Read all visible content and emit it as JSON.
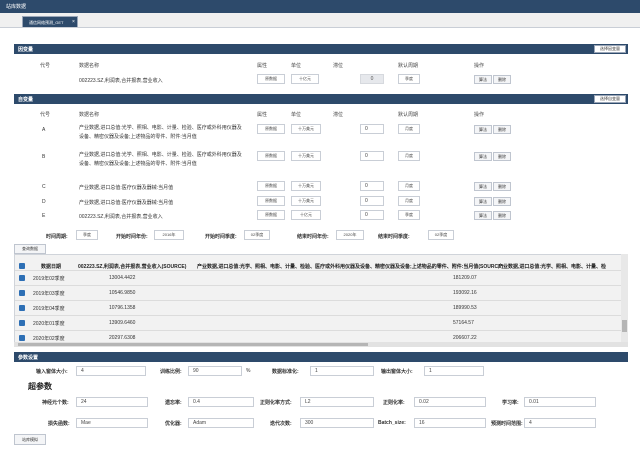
{
  "topbar": {
    "title": "站库数据"
  },
  "tab": {
    "label": "通信网络预测_GET",
    "close": "×"
  },
  "dependent": {
    "title": "因变量",
    "select_btn": "选择因变量",
    "headers": {
      "code": "代号",
      "name": "数据名称",
      "attr": "属性",
      "unit": "单位",
      "lag": "滞位",
      "freq": "默认周期",
      "ops": "操作"
    },
    "row": {
      "name": "002223.SZ,利润表,合并报表,营业收入",
      "attr": "原数据",
      "unit": "十亿元",
      "lag": "0",
      "freq": "季度",
      "btn_edit": "算法",
      "btn_del": "删除"
    }
  },
  "independent": {
    "title": "自变量",
    "select_btn": "选择自变量",
    "headers": {
      "code": "代号",
      "name": "数据名称",
      "attr": "属性",
      "unit": "单位",
      "lag": "滞位",
      "freq": "默认周期",
      "ops": "操作"
    },
    "rows": [
      {
        "code": "A",
        "name": "产业数据,进口总值:光学、照相、电影、计量、检验、医疗或外科用仪器及设备、精密仪器及设备;上述物品的零件、附件:当月值",
        "attr": "原数据",
        "unit": "十万美元",
        "lag": "0",
        "freq": "月度",
        "btn_edit": "算法",
        "btn_del": "删除"
      },
      {
        "code": "B",
        "name": "产业数据,进口总值:光学、照相、电影、计量、检验、医疗或外科用仪器及设备、精密仪器及设备;上述物品的零件、附件:当月值",
        "attr": "原数据",
        "unit": "十万美元",
        "lag": "0",
        "freq": "月度",
        "btn_edit": "算法",
        "btn_del": "删除"
      },
      {
        "code": "C",
        "name": "产业数据,进口总值:医疗仪器及器械:当月值",
        "attr": "原数据",
        "unit": "十万美元",
        "lag": "0",
        "freq": "月度",
        "btn_edit": "算法",
        "btn_del": "删除"
      },
      {
        "code": "D",
        "name": "产业数据,进口总值:医疗仪器及器械:当月值",
        "attr": "原数据",
        "unit": "十万美元",
        "lag": "0",
        "freq": "月度",
        "btn_edit": "算法",
        "btn_del": "删除"
      },
      {
        "code": "E",
        "name": "002223.SZ,利润表,合并报表,营业收入",
        "attr": "原数据",
        "unit": "十亿元",
        "lag": "0",
        "freq": "季度",
        "btn_edit": "算法",
        "btn_del": "删除"
      }
    ]
  },
  "time_filter": {
    "period_label": "时间周期:",
    "period_value": "季度",
    "start_year_label": "开始时间年份:",
    "start_year_value": "2016年",
    "start_q_label": "开始时间季度:",
    "start_q_value": "02季度",
    "end_year_label": "结束时间年份:",
    "end_year_value": "2020年",
    "end_q_label": "结束时间季度:",
    "end_q_value": "02季度",
    "query_btn": "查询数据"
  },
  "data_table": {
    "headers": [
      "数据日期",
      "002223.SZ,利润表,合并报表,营业收入(SOURCE)",
      "产业数据,进口总值:光学、照相、电影、计量、检验、医疗或外科用仪器及设备、精密仪器及设备;上述物品的零件、附件:当月值(SOURCE)",
      "产业数据,进口总值:光学、照相、电影、计量、检"
    ],
    "rows": [
      {
        "date": "2019年02季度",
        "v1": "13004.4422",
        "v2": "181209.07"
      },
      {
        "date": "2019年03季度",
        "v1": "10546.9850",
        "v2": "193092.16"
      },
      {
        "date": "2019年04季度",
        "v1": "10796.1358",
        "v2": "189990.53"
      },
      {
        "date": "2020年01季度",
        "v1": "13909.6460",
        "v2": "57164.57"
      },
      {
        "date": "2020年02季度",
        "v1": "20297.6308",
        "v2": "206607.22"
      }
    ]
  },
  "params": {
    "title": "参数设置",
    "input_window_label": "输入窗体大小:",
    "input_window_value": "4",
    "train_ratio_label": "训练比例:",
    "train_ratio_value": "90",
    "train_ratio_unit": "%",
    "normalize_label": "数据标准化:",
    "normalize_value": "1",
    "output_window_label": "输出窗体大小:",
    "output_window_value": "1",
    "hyper_title": "超参数",
    "neurons_label": "神经元个数:",
    "neurons_value": "24",
    "forget_label": "遗忘率:",
    "forget_value": "0.4",
    "reg_method_label": "正则化率方式:",
    "reg_method_value": "L2",
    "reg_rate_label": "正则化率:",
    "reg_rate_value": "0.02",
    "lr_label": "学习率:",
    "lr_value": "0.01",
    "loss_label": "损失函数:",
    "loss_value": "Mae",
    "optimizer_label": "优化器:",
    "optimizer_value": "Adam",
    "iter_label": "迭代次数:",
    "iter_value": "300",
    "batch_label": "Batch_size:",
    "batch_value": "16",
    "horizon_label": "预测时间范围:",
    "horizon_value": "4",
    "submit_btn": "站库模拟"
  }
}
